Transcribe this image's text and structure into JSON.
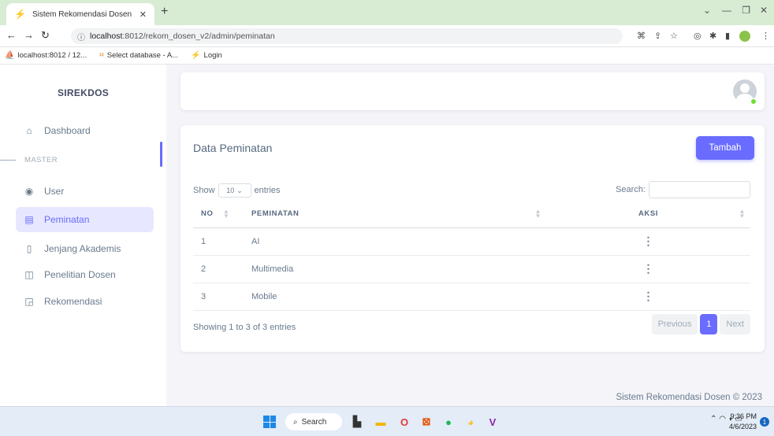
{
  "browser": {
    "tab_title": "Sistem Rekomendasi Dosen",
    "url_host": "localhost",
    "url_path": ":8012/rekom_dosen_v2/admin/peminatan",
    "bookmarks": [
      {
        "label": "localhost:8012 / 12...",
        "icon": "phpmyadmin-icon"
      },
      {
        "label": "Select database - A...",
        "icon": "database-icon"
      },
      {
        "label": "Login",
        "icon": "bolt-icon"
      }
    ]
  },
  "sidebar": {
    "brand": "SIREKDOS",
    "items": [
      {
        "label": "Dashboard",
        "icon": "home-icon"
      },
      {
        "label": "User",
        "icon": "user-circle-icon"
      },
      {
        "label": "Peminatan",
        "icon": "clipboard-icon",
        "active": true
      },
      {
        "label": "Jenjang Akademis",
        "icon": "book-icon"
      },
      {
        "label": "Penelitian Dosen",
        "icon": "open-book-icon"
      },
      {
        "label": "Rekomendasi",
        "icon": "report-icon"
      }
    ],
    "section_master": "MASTER"
  },
  "card": {
    "title": "Data Peminatan",
    "add_label": "Tambah",
    "show_label": "Show",
    "length_value": "10",
    "entries_label": "entries",
    "search_label": "Search:",
    "search_value": "",
    "columns": [
      "NO",
      "PEMINATAN",
      "AKSI"
    ],
    "rows": [
      {
        "no": "1",
        "peminatan": "AI",
        "aksi": "⋮"
      },
      {
        "no": "2",
        "peminatan": "Multimedia",
        "aksi": "⋮"
      },
      {
        "no": "3",
        "peminatan": "Mobile",
        "aksi": "⋮"
      }
    ],
    "info": "Showing 1 to 3 of 3 entries",
    "pager": {
      "previous": "Previous",
      "current": "1",
      "next": "Next"
    }
  },
  "footer": "Sistem Rekomendasi Dosen © 2023",
  "taskbar": {
    "search_label": "Search",
    "time": "9:36 PM",
    "date": "4/6/2023",
    "notification_count": "1"
  },
  "colors": {
    "accent": "#696cff",
    "active_bg": "#e7e7ff",
    "status_online": "#71dd37"
  }
}
